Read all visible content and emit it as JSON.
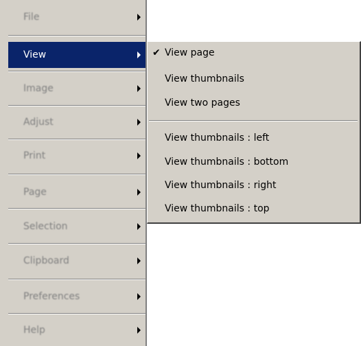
{
  "main_menu": {
    "items": [
      {
        "label": "File",
        "active": false
      },
      {
        "label": "View",
        "active": true
      },
      {
        "label": "Image",
        "active": false
      },
      {
        "label": "Adjust",
        "active": false
      },
      {
        "label": "Print",
        "active": false
      },
      {
        "label": "Page",
        "active": false
      },
      {
        "label": "Selection",
        "active": false
      },
      {
        "label": "Clipboard",
        "active": false
      },
      {
        "label": "Preferences",
        "active": false
      },
      {
        "label": "Help",
        "active": false
      }
    ]
  },
  "view_submenu": {
    "check_glyph": "✔",
    "items": [
      {
        "label": "View page",
        "checked": true
      },
      {
        "label": "View thumbnails",
        "checked": false
      },
      {
        "label": "View two pages",
        "checked": false
      },
      {
        "label": "View thumbnails : left",
        "checked": false
      },
      {
        "label": "View thumbnails : bottom",
        "checked": false
      },
      {
        "label": "View thumbnails : right",
        "checked": false
      },
      {
        "label": "View thumbnails : top",
        "checked": false
      }
    ]
  },
  "colors": {
    "menu_bg": "#d4d0c8",
    "highlight_bg": "#0a246a",
    "highlight_text": "#ffffff"
  }
}
